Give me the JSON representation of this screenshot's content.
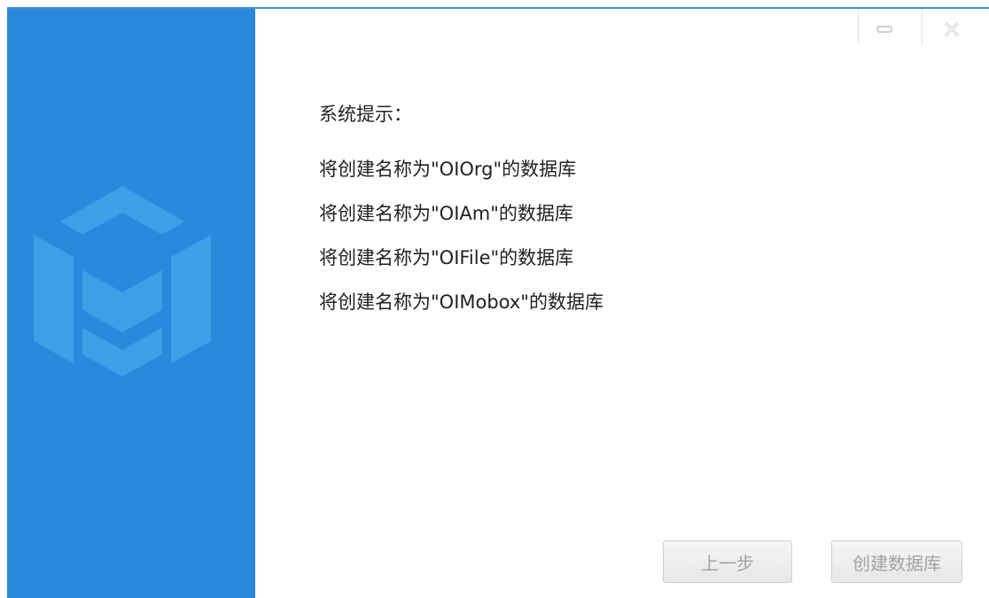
{
  "window": {
    "minimize_icon": "minimize-icon",
    "close_icon": "close-icon",
    "accent_color": "#2a89dd"
  },
  "sidebar": {
    "logo_icon": "cube-m-logo-icon",
    "background_color": "#2a89dd",
    "logo_color": "#3da0e6"
  },
  "main": {
    "prompt_title": "系统提示：",
    "messages": [
      "将创建名称为\"OIOrg\"的数据库",
      "将创建名称为\"OIAm\"的数据库",
      "将创建名称为\"OIFile\"的数据库",
      "将创建名称为\"OIMobox\"的数据库"
    ]
  },
  "footer": {
    "prev_label": "上一步",
    "create_label": "创建数据库",
    "prev_enabled": false,
    "create_enabled": false
  }
}
